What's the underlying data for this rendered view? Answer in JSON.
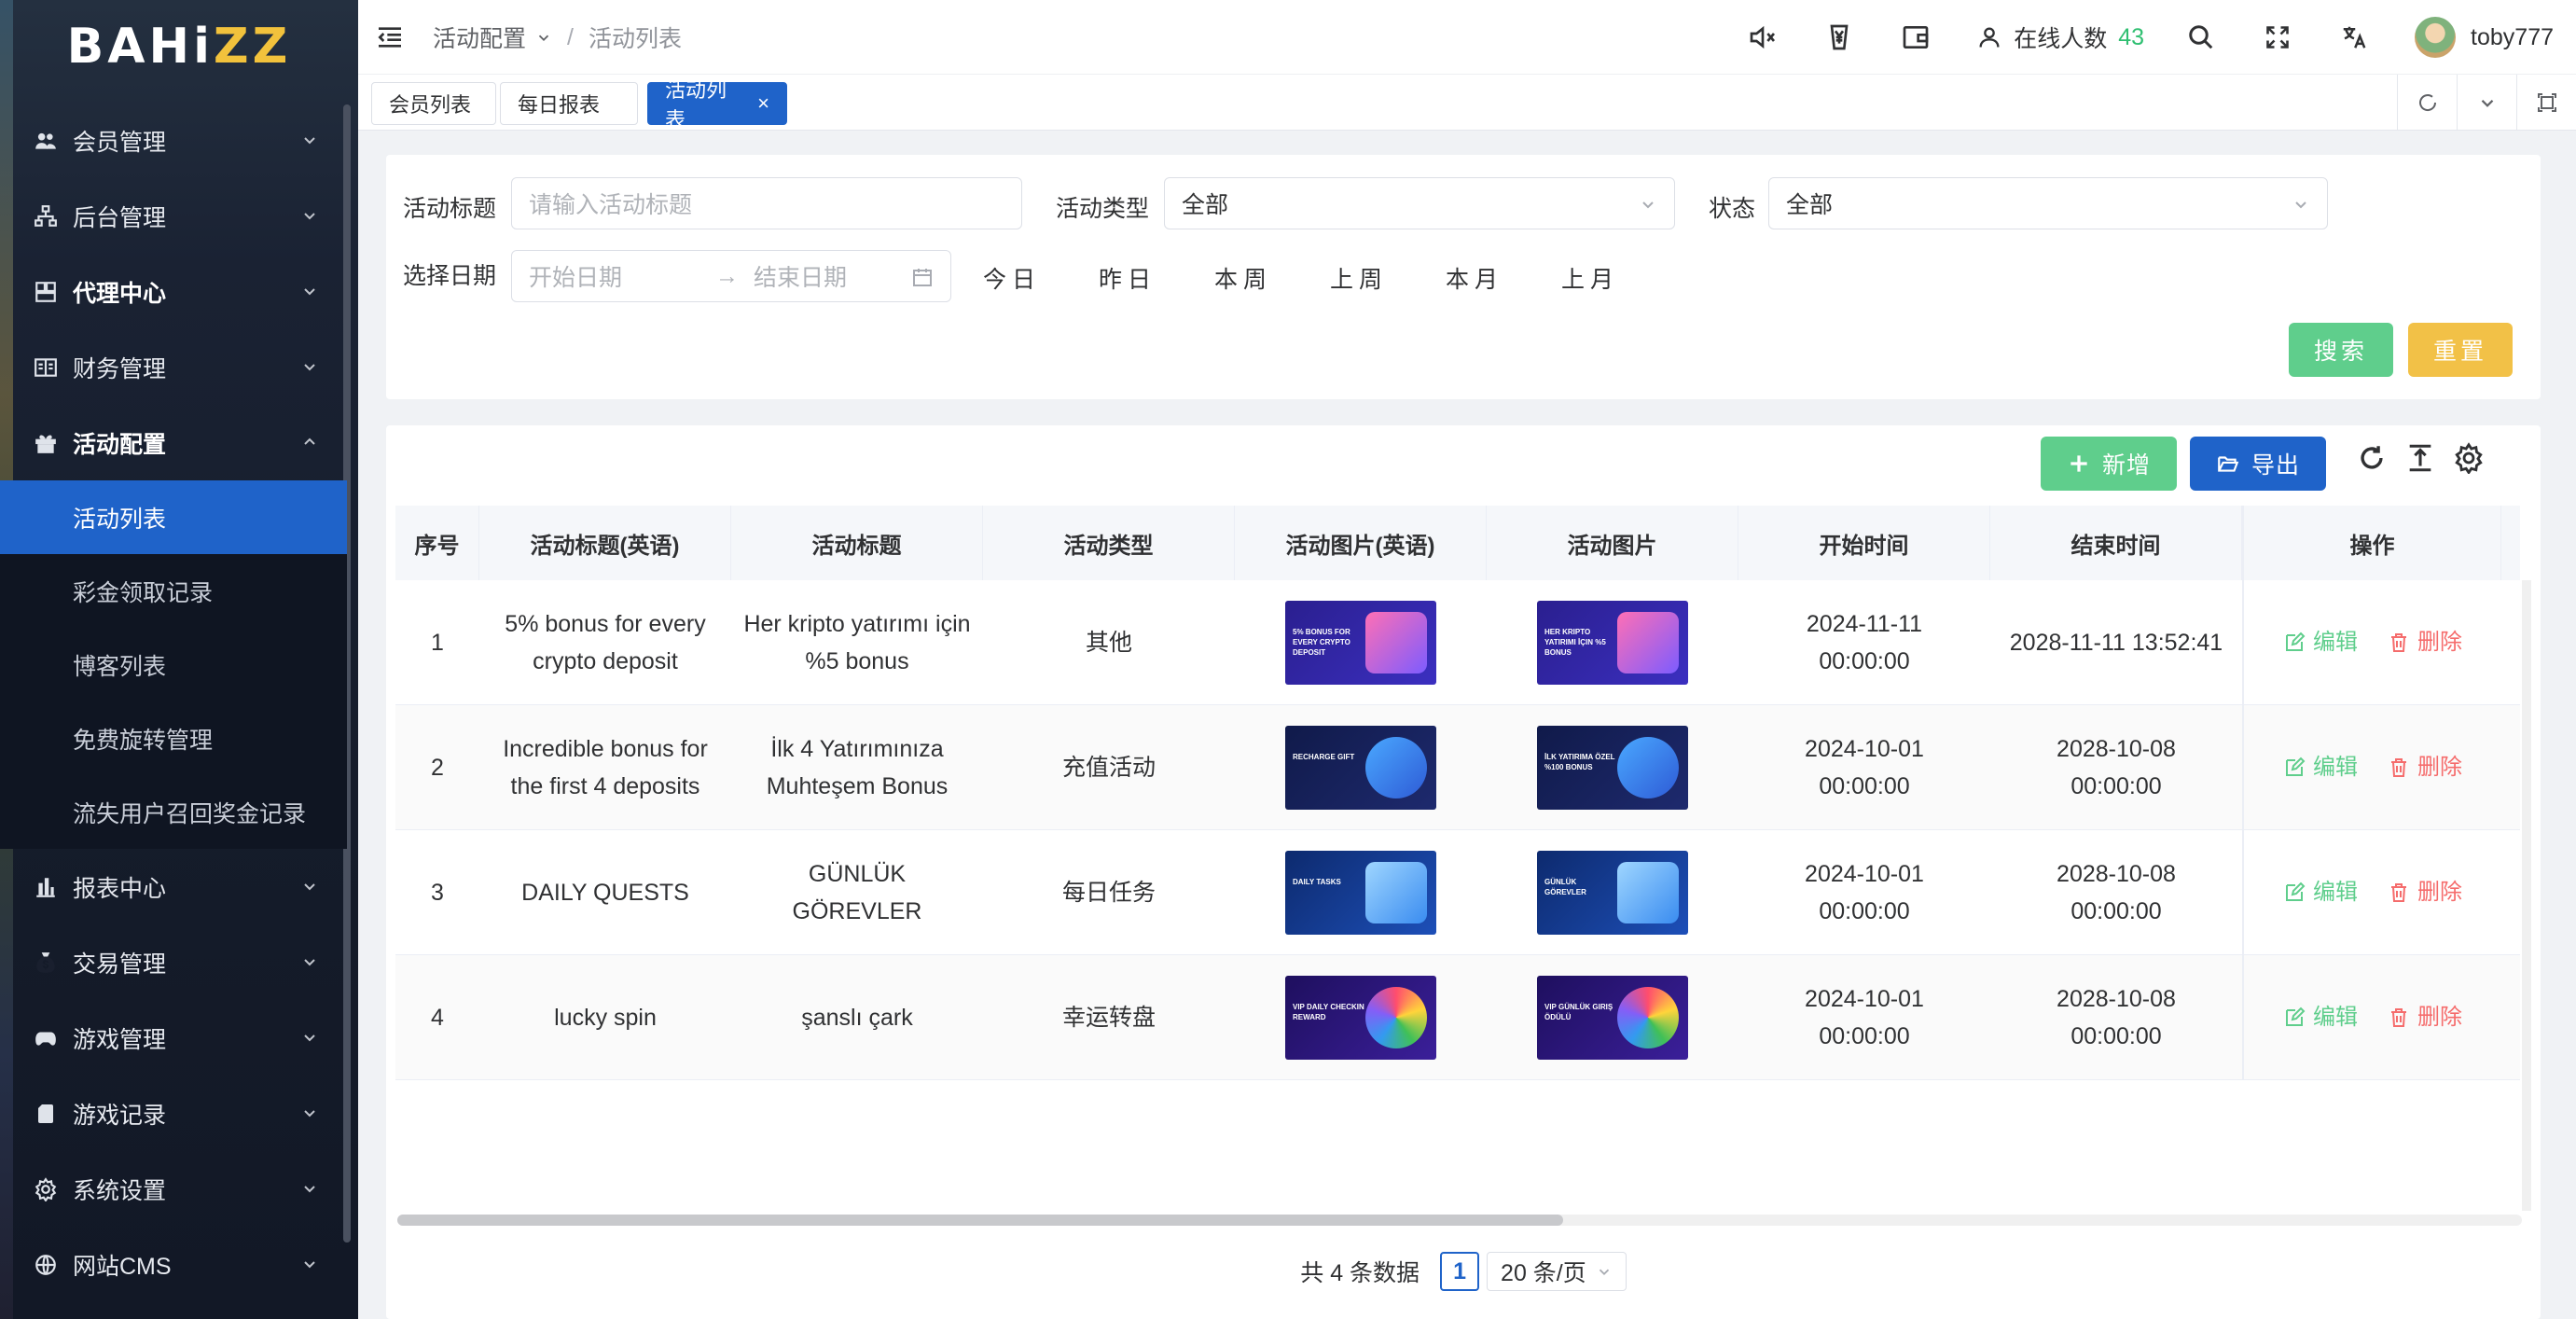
{
  "brand": {
    "logo_a": "BAHi",
    "logo_b": "ZZ"
  },
  "sidebar": {
    "items": [
      {
        "label": "会员管理",
        "icon": "users-icon"
      },
      {
        "label": "后台管理",
        "icon": "org-chart-icon"
      },
      {
        "label": "代理中心",
        "icon": "grid-icon"
      },
      {
        "label": "财务管理",
        "icon": "ledger-icon"
      },
      {
        "label": "活动配置",
        "icon": "gift-icon"
      }
    ],
    "sub_items": [
      "活动列表",
      "彩金领取记录",
      "博客列表",
      "免费旋转管理",
      "流失用户召回奖金记录"
    ],
    "items_after": [
      {
        "label": "报表中心",
        "icon": "bar-chart-icon"
      },
      {
        "label": "交易管理",
        "icon": "money-bag-icon"
      },
      {
        "label": "游戏管理",
        "icon": "gamepad-icon"
      },
      {
        "label": "游戏记录",
        "icon": "sd-card-icon"
      },
      {
        "label": "系统设置",
        "icon": "gear-icon"
      },
      {
        "label": "网站CMS",
        "icon": "globe-icon"
      }
    ]
  },
  "header": {
    "breadcrumb_parent": "活动配置",
    "breadcrumb_sep": "/",
    "breadcrumb_current": "活动列表",
    "online_label": "在线人数",
    "online_count": "43",
    "username": "toby777"
  },
  "tabs": [
    {
      "label": "会员列表"
    },
    {
      "label": "每日报表"
    },
    {
      "label": "活动列表",
      "close": "×"
    }
  ],
  "filter": {
    "title_label": "活动标题",
    "title_placeholder": "请输入活动标题",
    "type_label": "活动类型",
    "type_value": "全部",
    "status_label": "状态",
    "status_value": "全部",
    "date_label": "选择日期",
    "start_placeholder": "开始日期",
    "date_arrow": "→",
    "end_placeholder": "结束日期",
    "quick": [
      "今日",
      "昨日",
      "本周",
      "上周",
      "本月",
      "上月"
    ],
    "search_label": "搜索",
    "reset_label": "重置"
  },
  "toolbar": {
    "add_label": "新增",
    "export_label": "导出"
  },
  "table": {
    "headers": [
      "序号",
      "活动标题(英语)",
      "活动标题",
      "活动类型",
      "活动图片(英语)",
      "活动图片",
      "开始时间",
      "结束时间",
      "操作"
    ],
    "rows": [
      {
        "no": "1",
        "title_en": "5% bonus for every crypto deposit",
        "title": "Her kripto yatırımı için %5 bonus",
        "type": "其他",
        "img_en": "5% BONUS FOR EVERY CRYPTO DEPOSIT",
        "img": "HER KRIPTO YATIRIMI İÇIN %5 BONUS",
        "start_date": "2024-11-11",
        "start_time": "00:00:00",
        "end_date": "2028-11-11 13:52:41",
        "end_time": ""
      },
      {
        "no": "2",
        "title_en": "Incredible bonus for the first 4 deposits",
        "title": "İlk 4 Yatırımınıza Muhteşem Bonus",
        "type": "充值活动",
        "img_en": "RECHARGE GIFT",
        "img": "İLK YATIRIMA ÖZEL %100 BONUS",
        "start_date": "2024-10-01",
        "start_time": "00:00:00",
        "end_date": "2028-10-08",
        "end_time": "00:00:00"
      },
      {
        "no": "3",
        "title_en": "DAILY QUESTS",
        "title": "GÜNLÜK GÖREVLER",
        "type": "每日任务",
        "img_en": "DAILY TASKS",
        "img": "GÜNLÜK GÖREVLER",
        "start_date": "2024-10-01",
        "start_time": "00:00:00",
        "end_date": "2028-10-08",
        "end_time": "00:00:00"
      },
      {
        "no": "4",
        "title_en": "lucky spin",
        "title": "şanslı çark",
        "type": "幸运转盘",
        "img_en": "VIP DAILY CHECKIN REWARD",
        "img": "VIP GÜNLÜK GIRIŞ ÖDÜLÜ",
        "start_date": "2024-10-01",
        "start_time": "00:00:00",
        "end_date": "2028-10-08",
        "end_time": "00:00:00"
      }
    ],
    "edit_label": "编辑",
    "delete_label": "删除"
  },
  "pager": {
    "total_text": "共 4 条数据",
    "page": "1",
    "page_size": "20 条/页"
  }
}
